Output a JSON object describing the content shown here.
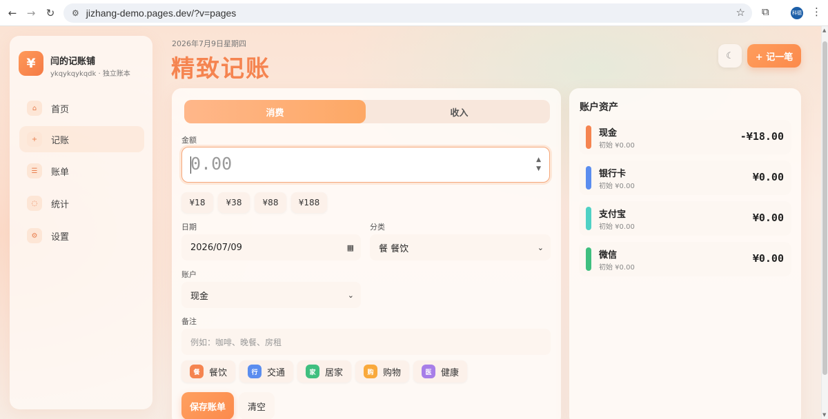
{
  "browser": {
    "url": "jizhang-demo.pages.dev/?v=pages",
    "profile_initials": "科德"
  },
  "sidebar": {
    "brand_icon": "¥",
    "brand_name": "闫的记账铺",
    "brand_sub": "ykqykqykqdk · 独立账本",
    "items": [
      {
        "label": "首页",
        "icon": "home-icon"
      },
      {
        "label": "记账",
        "icon": "plus-icon"
      },
      {
        "label": "账单",
        "icon": "list-icon"
      },
      {
        "label": "统计",
        "icon": "chart-icon"
      },
      {
        "label": "设置",
        "icon": "gear-icon"
      }
    ]
  },
  "header": {
    "date": "2026年7月9日星期四",
    "title": "精致记账",
    "add_button": "+ 记一笔"
  },
  "form": {
    "tabs": [
      "消费",
      "收入"
    ],
    "amount_label": "金额",
    "amount_value": "0.00",
    "quick_amounts": [
      "¥18",
      "¥38",
      "¥88",
      "¥188"
    ],
    "date_label": "日期",
    "date_value": "2026/07/09",
    "category_label": "分类",
    "category_value": "餐 餐饮",
    "account_label": "账户",
    "account_value": "现金",
    "note_label": "备注",
    "note_placeholder": "例如：咖啡、晚餐、房租",
    "categories": [
      {
        "glyph": "餐",
        "label": "餐饮",
        "color": "#f58450"
      },
      {
        "glyph": "行",
        "label": "交通",
        "color": "#5b8def"
      },
      {
        "glyph": "家",
        "label": "居家",
        "color": "#3fbf7f"
      },
      {
        "glyph": "购",
        "label": "购物",
        "color": "#f9a93c"
      },
      {
        "glyph": "医",
        "label": "健康",
        "color": "#a77ee8"
      }
    ],
    "save_button": "保存账单",
    "clear_button": "清空"
  },
  "accounts": {
    "title": "账户资产",
    "items": [
      {
        "name": "现金",
        "initial": "初始 ¥0.00",
        "balance": "-¥18.00",
        "color": "#f58450"
      },
      {
        "name": "银行卡",
        "initial": "初始 ¥0.00",
        "balance": "¥0.00",
        "color": "#5b8def"
      },
      {
        "name": "支付宝",
        "initial": "初始 ¥0.00",
        "balance": "¥0.00",
        "color": "#4fd1c5"
      },
      {
        "name": "微信",
        "initial": "初始 ¥0.00",
        "balance": "¥0.00",
        "color": "#3fbf7f"
      }
    ]
  }
}
